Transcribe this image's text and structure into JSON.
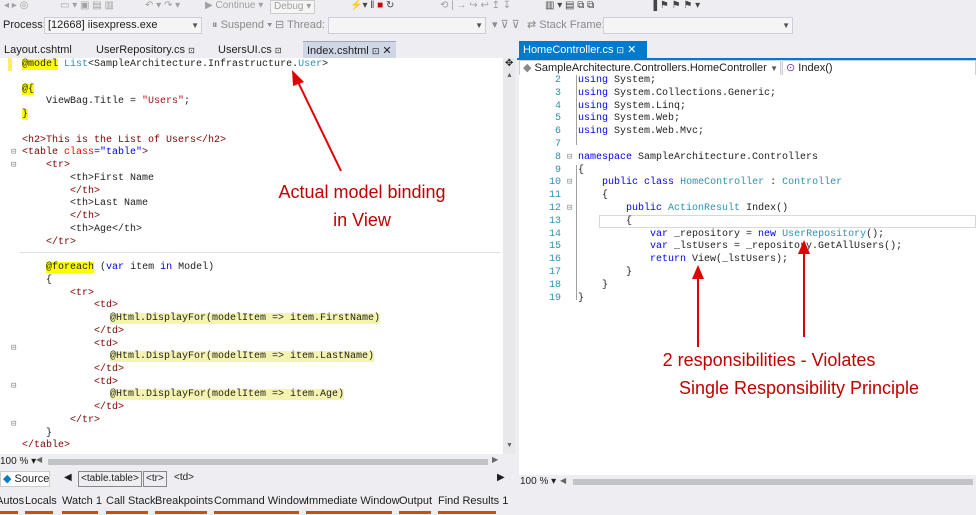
{
  "toolbar": {
    "continue_label": "Continue",
    "config_label": "Debug"
  },
  "processbar": {
    "process_label": "Process:",
    "process_value": "[12668] iisexpress.exe",
    "suspend_label": "Suspend",
    "thread_label": "Thread:",
    "stack_frame_label": "Stack Frame:"
  },
  "left_tabs": [
    {
      "label": "Layout.cshtml"
    },
    {
      "label": "UserRepository.cs"
    },
    {
      "label": "UsersUI.cs"
    },
    {
      "label": "Index.cshtml"
    }
  ],
  "right_tabs": [
    {
      "label": "HomeController.cs"
    }
  ],
  "right_nav": {
    "class_combo": "SampleArchitecture.Controllers.HomeController",
    "member_combo": "Index()"
  },
  "left_code": {
    "l1_model": "@model",
    "l1_list": " List",
    "l1_ns": "<SampleArchitecture.Infrastructure.",
    "l1_user": "User",
    "l1_end": ">",
    "l3": "@{",
    "l4_a": "    ViewBag.Title = ",
    "l4_str": "\"Users\"",
    "l4_b": ";",
    "l5": "}",
    "l7": "<h2>This is the List of Users</h2>",
    "l8_a": "<table ",
    "l8_attr": "class",
    "l8_b": "=",
    "l8_str": "\"table\"",
    "l8_c": ">",
    "l9": "    <tr>",
    "l10": "        <th>First Name",
    "l11": "        </th>",
    "l12": "        <th>Last Name",
    "l13": "        </th>",
    "l14": "        <th>Age</th>",
    "l15": "    </tr>",
    "l17_foreach": "@foreach",
    "l17_a": " (",
    "l17_var": "var",
    "l17_b": " item ",
    "l17_in": "in",
    "l17_c": " Model)",
    "l18": "    {",
    "l19": "        <tr>",
    "l20": "            <td>",
    "l21": "@Html.DisplayFor(modelItem => item.FirstName)",
    "l22": "            </td>",
    "l23": "            <td>",
    "l24": "@Html.DisplayFor(modelItem => item.LastName)",
    "l25": "            </td>",
    "l26": "            <td>",
    "l27": "@Html.DisplayFor(modelItem => item.Age)",
    "l28": "            </td>",
    "l29": "        </tr>",
    "l30": "    }",
    "l31": "</table>"
  },
  "right_code": {
    "lines": [
      "2",
      "3",
      "4",
      "5",
      "6",
      "7",
      "8",
      "9",
      "10",
      "11",
      "12",
      "13",
      "14",
      "15",
      "16",
      "17",
      "18",
      "19"
    ],
    "u1": "System;",
    "u2": "System.Collections.Generic;",
    "u3": "System.Linq;",
    "u4": "System.Web;",
    "u5": "System.Web.Mvc;",
    "using_kw": "using",
    "ns_kw": "namespace",
    "ns_name": " SampleArchitecture.Controllers",
    "ob1": "{",
    "pub": "public",
    "cls": "class",
    "home": "HomeController",
    "colon": " : ",
    "ctrl": "Controller",
    "ob2": "{",
    "ar": "ActionResult",
    "idx": " Index()",
    "ob3": "{",
    "var": "var",
    "r1a": " _repository = ",
    "new": "new",
    "urepo": "UserRepository",
    "r1b": "();",
    "r2a": " _lstUsers = _repository.GetAllUsers();",
    "ret": "return",
    "r3": " View(_lstUsers);",
    "cb3": "}",
    "cb2": "}",
    "cb1": "}"
  },
  "annotations": {
    "left_line1": "Actual model binding",
    "left_line2": "in View",
    "right_line1": "2 responsibilities - Violates",
    "right_line2": "Single Responsibility Principle"
  },
  "left_status": {
    "zoom": "100 %",
    "source_label": "Source",
    "crumbs": [
      "<table.table>",
      "<tr>",
      "<td>"
    ]
  },
  "right_status": {
    "zoom": "100 %"
  },
  "bottom_tabs": [
    "Autos",
    "Locals",
    "Watch 1",
    "Call Stack",
    "Breakpoints",
    "Command Window",
    "Immediate Window",
    "Output",
    "Find Results 1"
  ],
  "colors": {
    "annotation": "#c00000",
    "active_tab": "#007acc",
    "keyword": "#0000ff",
    "type": "#2b91af"
  }
}
